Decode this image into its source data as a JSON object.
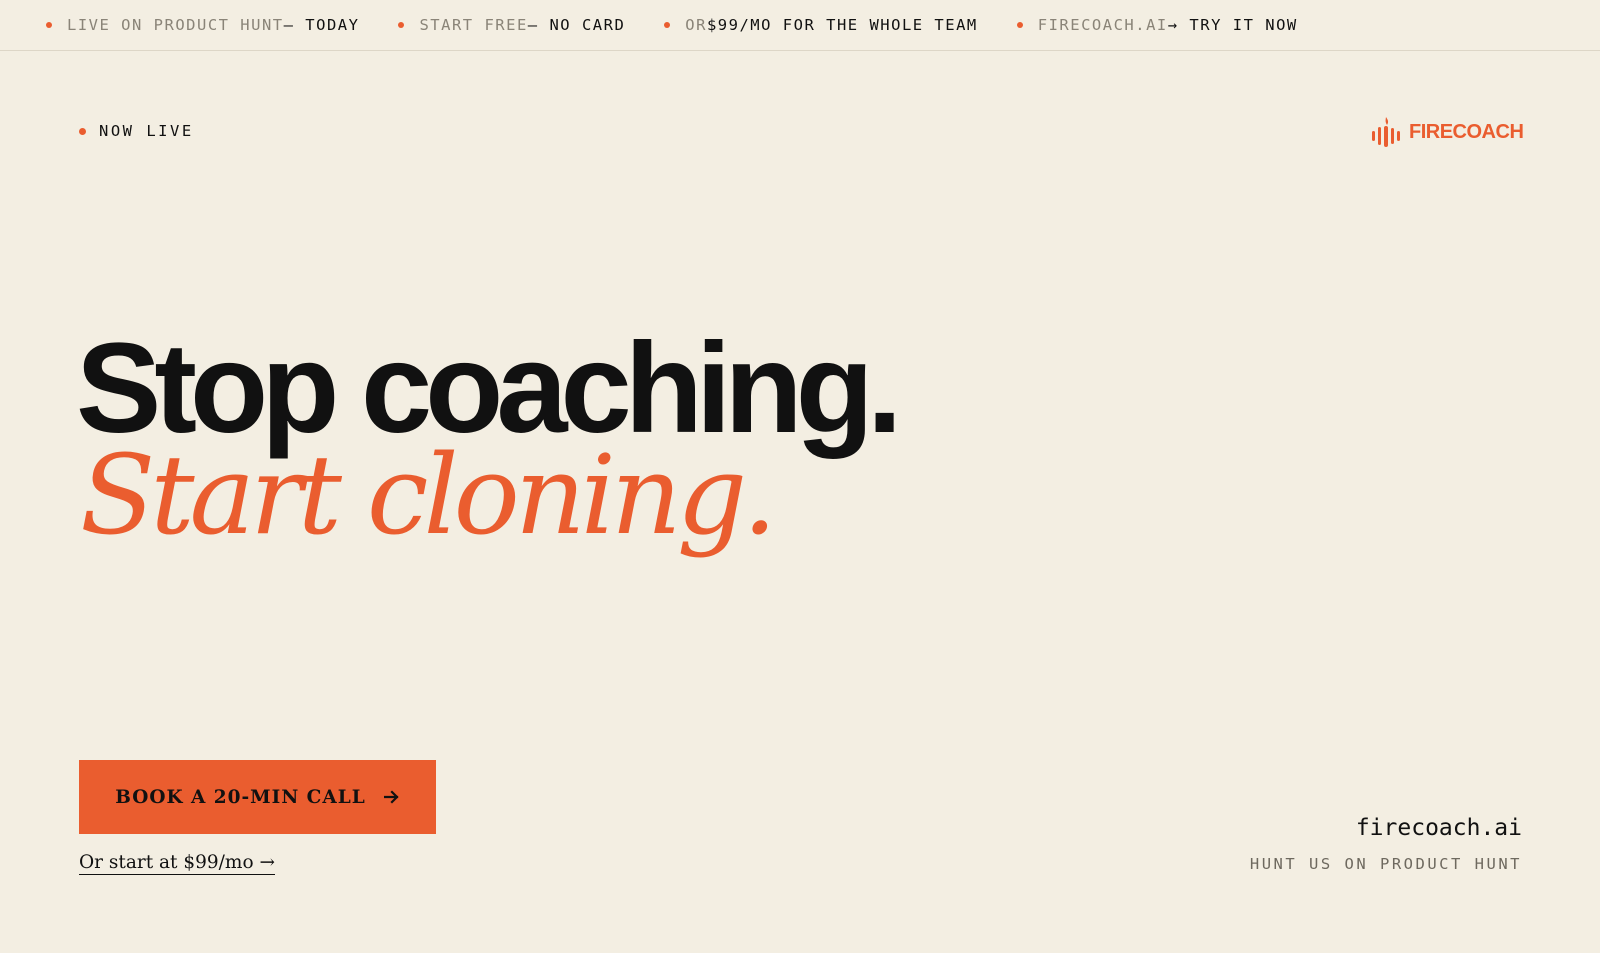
{
  "ticker": [
    {
      "muted": "LIVE ON PRODUCT HUNT",
      "strong": " — TODAY"
    },
    {
      "muted": "START FREE",
      "strong": " — NO CARD"
    },
    {
      "muted": "OR",
      "strong": " $99/MO FOR THE WHOLE TEAM"
    },
    {
      "muted": "FIRECOACH.AI",
      "strong": " → TRY IT NOW"
    }
  ],
  "status": {
    "label": "NOW LIVE"
  },
  "logo": {
    "text": "FIRECOACH"
  },
  "hero": {
    "headline": "Stop coaching.",
    "subline": "Start cloning."
  },
  "cta": {
    "label": "BOOK A 20-MIN CALL",
    "secondary": "Or start at $99/mo →"
  },
  "footer": {
    "site": "firecoach.ai",
    "hunt": "HUNT US ON PRODUCT HUNT"
  },
  "colors": {
    "background": "#f3eee2",
    "accent": "#ea5d2f",
    "text": "#111111"
  },
  "icons": [
    "status-dot-icon",
    "firecoach-logo-icon",
    "arrow-right-icon"
  ]
}
